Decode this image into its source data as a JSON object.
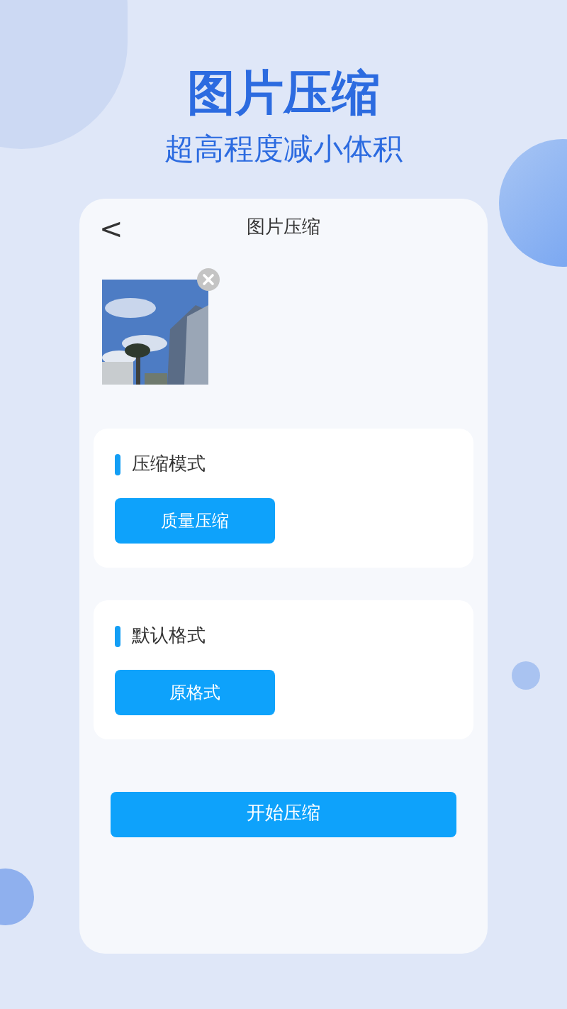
{
  "promo": {
    "title": "图片压缩",
    "subtitle": "超高程度减小体积"
  },
  "screen": {
    "back": "<",
    "title": "图片压缩"
  },
  "sections": [
    {
      "heading": "压缩模式",
      "option": "质量压缩"
    },
    {
      "heading": "默认格式",
      "option": "原格式"
    }
  ],
  "action": "开始压缩"
}
